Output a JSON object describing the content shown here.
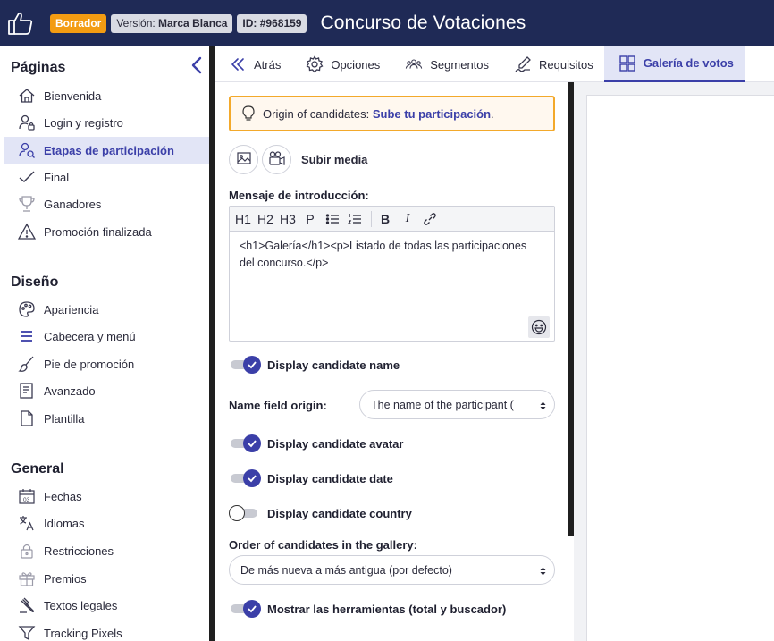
{
  "header": {
    "draft_badge": "Borrador",
    "version_prefix": "Versión:",
    "version_value": "Marca Blanca",
    "id_label": "ID: #968159",
    "title": "Concurso de Votaciones"
  },
  "sidebar": {
    "sections": [
      {
        "title": "Páginas",
        "items": [
          {
            "label": "Bienvenida",
            "icon": "home-icon"
          },
          {
            "label": "Login y registro",
            "icon": "user-lock-icon"
          },
          {
            "label": "Etapas de participación",
            "icon": "user-search-icon",
            "active": true
          },
          {
            "label": "Final",
            "icon": "check-icon"
          },
          {
            "label": "Ganadores",
            "icon": "trophy-icon"
          },
          {
            "label": "Promoción finalizada",
            "icon": "warning-icon"
          }
        ]
      },
      {
        "title": "Diseño",
        "items": [
          {
            "label": "Apariencia",
            "icon": "palette-icon"
          },
          {
            "label": "Cabecera y menú",
            "icon": "menu-icon"
          },
          {
            "label": "Pie de promoción",
            "icon": "brush-icon"
          },
          {
            "label": "Avanzado",
            "icon": "code-document-icon"
          },
          {
            "label": "Plantilla",
            "icon": "document-icon"
          }
        ]
      },
      {
        "title": "General",
        "items": [
          {
            "label": "Fechas",
            "icon": "calendar-icon"
          },
          {
            "label": "Idiomas",
            "icon": "translate-icon"
          },
          {
            "label": "Restricciones",
            "icon": "lock-icon"
          },
          {
            "label": "Premios",
            "icon": "gift-icon"
          },
          {
            "label": "Textos legales",
            "icon": "gavel-icon"
          },
          {
            "label": "Tracking Pixels",
            "icon": "filter-icon"
          }
        ]
      }
    ]
  },
  "tabs": [
    {
      "label": "Atrás",
      "icon": "double-chevron-left-icon"
    },
    {
      "label": "Opciones",
      "icon": "gear-icon"
    },
    {
      "label": "Segmentos",
      "icon": "users-icon"
    },
    {
      "label": "Requisitos",
      "icon": "signature-icon"
    },
    {
      "label": "Galería de votos",
      "icon": "grid-icon",
      "active": true
    }
  ],
  "content": {
    "hint_prefix": "Origin of candidates:",
    "hint_link": "Sube tu participación",
    "hint_suffix": ".",
    "media_label": "Subir media",
    "intro_label": "Mensaje de introducción:",
    "editor_toolbar": [
      "H1",
      "H2",
      "H3",
      "P"
    ],
    "editor_text": "<h1>Galería</h1><p>Listado de todas las participaciones del concurso.</p>",
    "toggles": {
      "name": {
        "label": "Display candidate name",
        "on": true
      },
      "avatar": {
        "label": "Display candidate avatar",
        "on": true
      },
      "date": {
        "label": "Display candidate date",
        "on": true
      },
      "country": {
        "label": "Display candidate country",
        "on": false
      },
      "tools": {
        "label": "Mostrar las herramientas (total y buscador)",
        "on": true
      }
    },
    "name_origin_label": "Name field origin:",
    "name_origin_value": "The name of the participant (",
    "order_label": "Order of candidates in the gallery:",
    "order_value": "De más nueva a más antigua (por defecto)"
  },
  "colors": {
    "topbar": "#1f2a56",
    "accent": "#3b3fa8",
    "draft": "#f39c12",
    "hint_border": "#f3a92b"
  }
}
